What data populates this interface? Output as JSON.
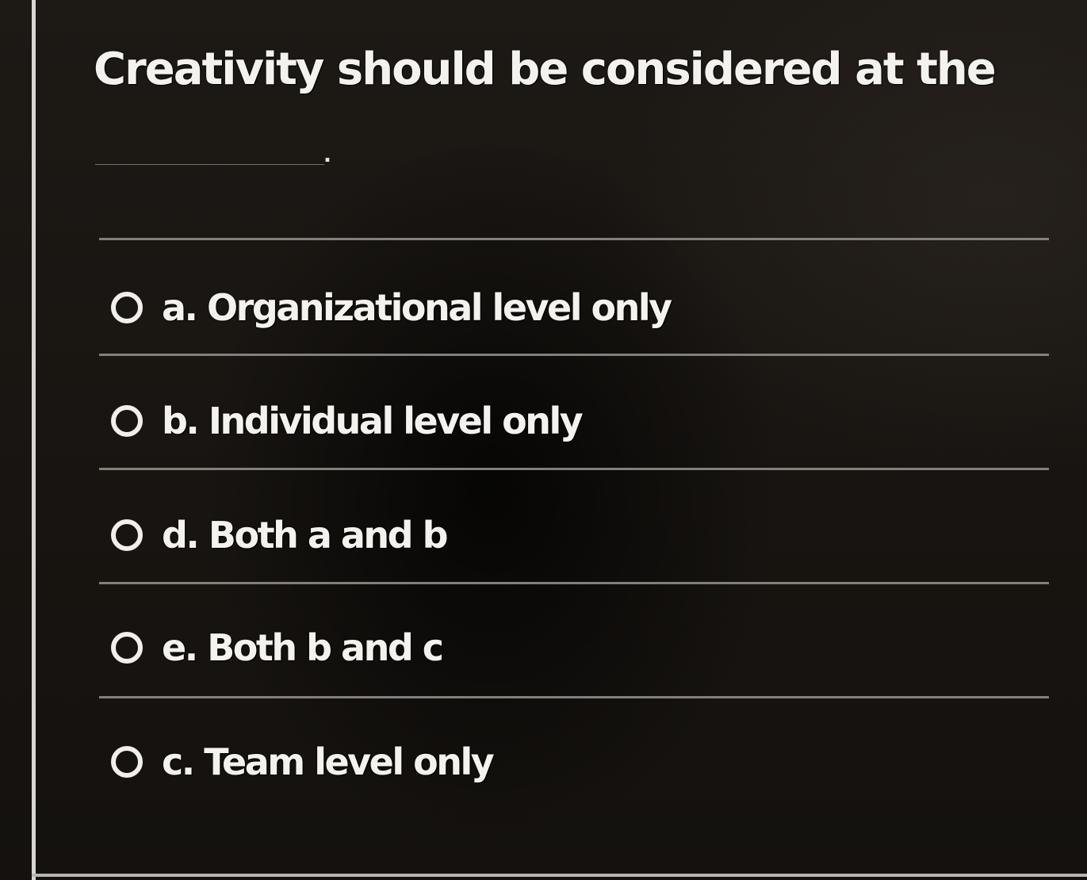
{
  "question": {
    "text": "Creativity should be considered at the",
    "blank": "________________________."
  },
  "options": [
    {
      "label": "a. Organizational level only",
      "selected": false
    },
    {
      "label": "b. Individual level only",
      "selected": false
    },
    {
      "label": "d. Both a and b",
      "selected": false
    },
    {
      "label": "e. Both b and c",
      "selected": false
    },
    {
      "label": "c. Team level only",
      "selected": false
    }
  ],
  "colors": {
    "background": "#1a1714",
    "text": "#f4f2ee",
    "divider": "#8f8c88",
    "border": "#d8d6d2"
  }
}
